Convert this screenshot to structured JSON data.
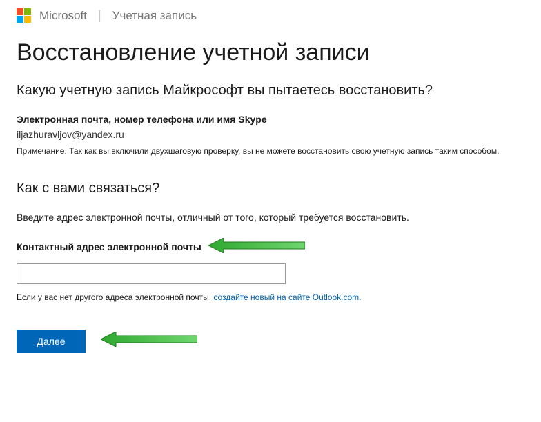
{
  "header": {
    "brand": "Microsoft",
    "subtitle": "Учетная запись"
  },
  "page": {
    "title": "Восстановление учетной записи"
  },
  "section1": {
    "heading": "Какую учетную запись Майкрософт вы пытаетесь восстановить?",
    "field_label": "Электронная почта, номер телефона или имя Skype",
    "field_value": "iljazhuravljov@yandex.ru",
    "note": "Примечание. Так как вы включили двухшаговую проверку, вы не можете восстановить свою учетную запись таким способом."
  },
  "section2": {
    "heading": "Как с вами связаться?",
    "instruction": "Введите адрес электронной почты, отличный от того, который требуется восстановить.",
    "contact_label": "Контактный адрес электронной почты",
    "helper_prefix": "Если у вас нет другого адреса электронной почты, ",
    "helper_link": "создайте новый на сайте Outlook.com."
  },
  "actions": {
    "next_label": "Далее"
  }
}
